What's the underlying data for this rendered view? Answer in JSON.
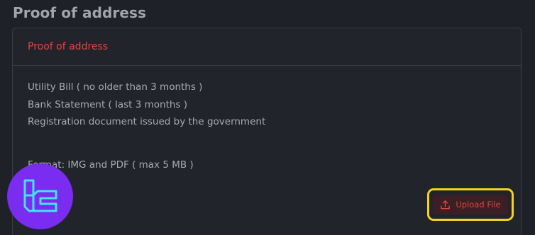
{
  "section": {
    "title": "Proof of address"
  },
  "card": {
    "header_title": "Proof of address",
    "requirements": [
      "Utility Bill ( no older than 3 months )",
      "Bank Statement ( last 3 months )",
      "Registration document issued by the government"
    ],
    "format": "Format: IMG and PDF ( max 5 MB )"
  },
  "upload": {
    "label": "Upload File",
    "icon": "upload-icon"
  },
  "colors": {
    "accent_red": "#e2453d",
    "highlight_yellow": "#f4d31b",
    "logo_purple": "#7a2cf0",
    "logo_cyan": "#3ee6f2"
  },
  "logo": {
    "icon": "tc-logo-icon"
  }
}
